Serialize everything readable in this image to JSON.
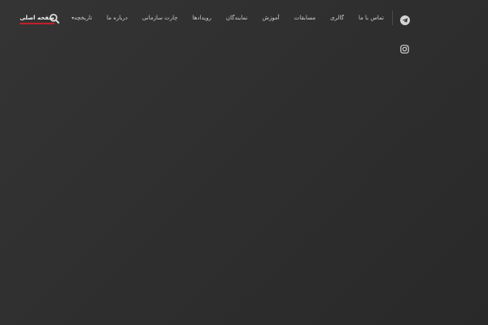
{
  "nav": {
    "search_icon": "search-icon",
    "items": [
      {
        "label": "صفحه اصلی",
        "active": true
      },
      {
        "label": "تاریخچه",
        "has_dropdown": true
      },
      {
        "label": "درباره ما"
      },
      {
        "label": "چارت سازمانی"
      },
      {
        "label": "رویدادها"
      },
      {
        "label": "نمایندگان"
      },
      {
        "label": "آموزش"
      },
      {
        "label": "مسابقات"
      },
      {
        "label": "گالری"
      },
      {
        "label": "تماس با ما"
      }
    ]
  },
  "social": {
    "telegram_icon": "telegram-icon",
    "instagram_icon": "instagram-icon"
  },
  "colors": {
    "accent": "#c0202a",
    "background": "#303030",
    "text": "#d6d6d6"
  }
}
